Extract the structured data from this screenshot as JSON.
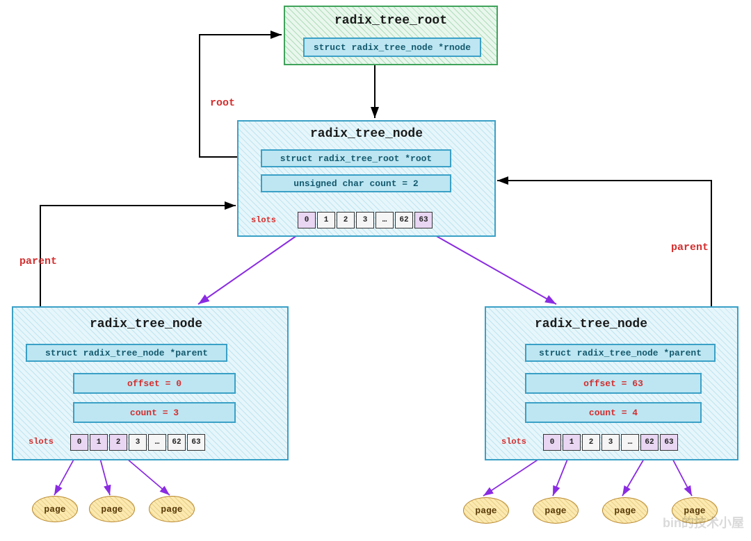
{
  "root_box": {
    "title": "radix_tree_root",
    "field": "struct radix_tree_node  *rnode"
  },
  "middle_node": {
    "title": "radix_tree_node",
    "field_root": "struct radix_tree_root *root",
    "field_count": "unsigned char count = 2",
    "slots_label": "slots",
    "slots": [
      "0",
      "1",
      "2",
      "3",
      "…",
      "62",
      "63"
    ],
    "purple_slots": [
      0,
      6
    ]
  },
  "left_node": {
    "title": "radix_tree_node",
    "field_parent": "struct radix_tree_node *parent",
    "field_offset": "offset = 0",
    "field_count": "count = 3",
    "slots_label": "slots",
    "slots": [
      "0",
      "1",
      "2",
      "3",
      "…",
      "62",
      "63"
    ],
    "purple_slots": [
      0,
      1,
      2
    ]
  },
  "right_node": {
    "title": "radix_tree_node",
    "field_parent": "struct radix_tree_node *parent",
    "field_offset": "offset = 63",
    "field_count": "count = 4",
    "slots_label": "slots",
    "slots": [
      "0",
      "1",
      "2",
      "3",
      "…",
      "62",
      "63"
    ],
    "purple_slots": [
      0,
      1,
      5,
      6
    ]
  },
  "edge_labels": {
    "root": "root",
    "parent_left": "parent",
    "parent_right": "parent"
  },
  "page_label": "page",
  "watermark": "bin的技术小屋"
}
